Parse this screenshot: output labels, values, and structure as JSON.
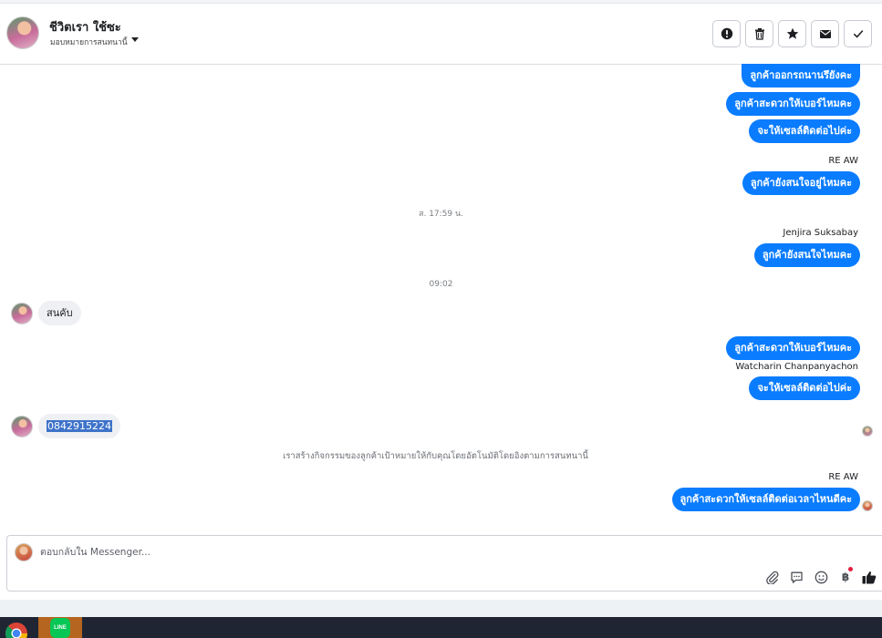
{
  "header": {
    "contact_name": "ชีวิตเรา ใช้ซะ",
    "assign_label": "มอบหมายการสนทนานี้",
    "actions": {
      "spam": "exclamation-icon",
      "delete": "trash-icon",
      "star": "star-icon",
      "unread": "envelope-icon",
      "done": "check-icon"
    }
  },
  "messages": {
    "out1": "ลูกค้าออกรถนานรึยังคะ",
    "out2": "ลูกค้าสะดวกให้เบอร์ไหมคะ",
    "out3": "จะให้เซลล์ติดต่อไปค่ะ",
    "sender1": "RE AW",
    "out4": "ลูกค้ายังสนใจอยู่ไหมคะ",
    "time1": "ส. 17:59 น.",
    "sender2": "Jenjira Suksabay",
    "out5": "ลูกค้ายังสนใจไหมคะ",
    "time2": "09:02",
    "in1": "สนคับ",
    "out6": "ลูกค้าสะดวกให้เบอร์ไหมคะ",
    "sender3": "Watcharin Chanpanyachon",
    "out7": "จะให้เซลล์ติดต่อไปค่ะ",
    "in2": "0842915224",
    "system_note": "เราสร้างกิจกรรมของลูกค้าเป้าหมายให้กับคุณโดยอัตโนมัติโดยอิงตามการสนทนานี้",
    "sender4": "RE AW",
    "out8": "ลูกค้าสะดวกให้เซลล์ติดต่อเวลาไหนดีคะ"
  },
  "composer": {
    "placeholder": "ตอบกลับใน Messenger...",
    "baht_symbol": "฿",
    "icons": [
      "paperclip-icon",
      "chat-icon",
      "emoji-icon",
      "baht-icon",
      "thumbs-up-icon"
    ]
  },
  "taskbar": {
    "line_label": "LINE",
    "apps": [
      "chrome-icon",
      "line-icon"
    ]
  },
  "colors": {
    "outgoing_bubble": "#0a7cff",
    "incoming_bubble": "#eef0f3",
    "taskbar": "#1f2533",
    "line_tile": "#b5651f"
  }
}
